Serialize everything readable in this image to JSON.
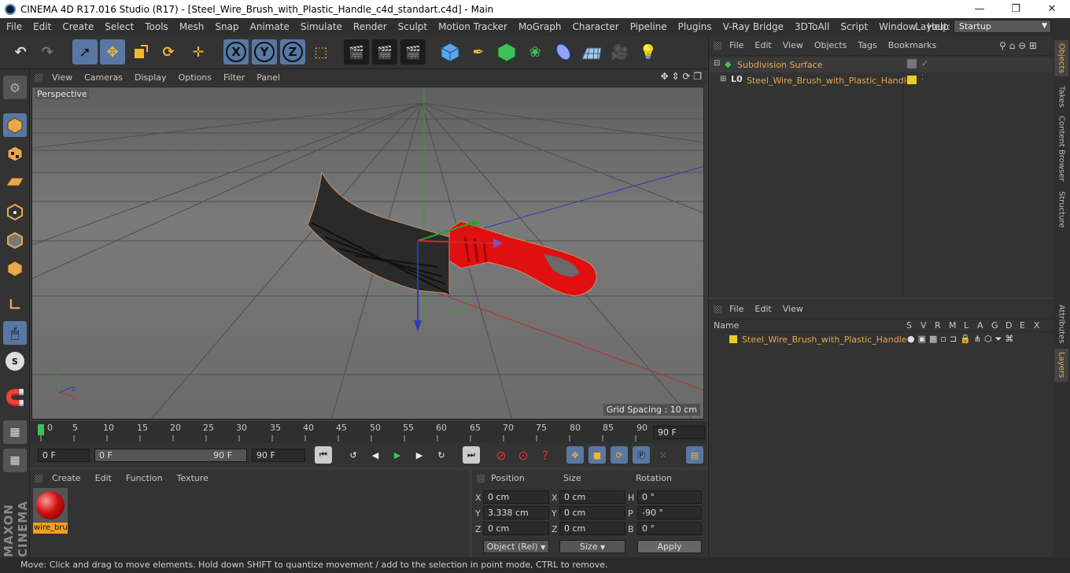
{
  "window": {
    "title": "CINEMA 4D R17.016 Studio (R17) - [Steel_Wire_Brush_with_Plastic_Handle_c4d_standart.c4d] - Main"
  },
  "menubar": {
    "items": [
      "File",
      "Edit",
      "Create",
      "Select",
      "Tools",
      "Mesh",
      "Snap",
      "Animate",
      "Simulate",
      "Render",
      "Sculpt",
      "Motion Tracker",
      "MoGraph",
      "Character",
      "Pipeline",
      "Plugins",
      "V-Ray Bridge",
      "3DToAll",
      "Script",
      "Window",
      "Help"
    ],
    "layout_label": "Layout:",
    "layout_value": "Startup"
  },
  "toolbar": {
    "axis_labels": [
      "X",
      "Y",
      "Z"
    ]
  },
  "viewport": {
    "menu": [
      "View",
      "Cameras",
      "Display",
      "Options",
      "Filter",
      "Panel"
    ],
    "camera_label": "Perspective",
    "grid_spacing": "Grid Spacing : 10 cm"
  },
  "timeline": {
    "ticks": [
      "0",
      "5",
      "10",
      "15",
      "20",
      "25",
      "30",
      "35",
      "40",
      "45",
      "50",
      "55",
      "60",
      "65",
      "70",
      "75",
      "80",
      "85",
      "90"
    ],
    "current_frame": "90 F",
    "start_field": "0 F",
    "range_start": "0 F",
    "range_end": "90 F",
    "end_field": "90 F"
  },
  "material_manager": {
    "menu": [
      "Create",
      "Edit",
      "Function",
      "Texture"
    ],
    "material_name": "wire_bru"
  },
  "coordinates": {
    "headers": [
      "Position",
      "Size",
      "Rotation"
    ],
    "rows": [
      {
        "axis": "X",
        "pos": "0 cm",
        "size_axis": "X",
        "size": "0 cm",
        "rot_axis": "H",
        "rot": "0 °"
      },
      {
        "axis": "Y",
        "pos": "3.338 cm",
        "size_axis": "Y",
        "size": "0 cm",
        "rot_axis": "P",
        "rot": "-90 °"
      },
      {
        "axis": "Z",
        "pos": "0 cm",
        "size_axis": "Z",
        "size": "0 cm",
        "rot_axis": "B",
        "rot": "0 °"
      }
    ],
    "mode_select": "Object (Rel)",
    "size_select": "Size",
    "apply_label": "Apply"
  },
  "object_manager": {
    "menu": [
      "File",
      "Edit",
      "View",
      "Objects",
      "Tags",
      "Bookmarks"
    ],
    "objects": [
      "Subdivision Surface",
      "Steel_Wire_Brush_with_Plastic_Handle"
    ]
  },
  "layer_manager": {
    "menu": [
      "File",
      "Edit",
      "View"
    ],
    "header_name": "Name",
    "columns": [
      "S",
      "V",
      "R",
      "M",
      "L",
      "A",
      "G",
      "D",
      "E",
      "X"
    ],
    "layers": [
      "Steel_Wire_Brush_with_Plastic_Handle"
    ]
  },
  "side_tabs": [
    "Objects",
    "Takes",
    "Content Browser",
    "Structure",
    "Attributes",
    "Layers"
  ],
  "status": {
    "text": "Move: Click and drag to move elements. Hold down SHIFT to quantize movement / add to the selection in point mode, CTRL to remove."
  },
  "colors": {
    "accent": "#e8a94b",
    "selection": "#5878a3",
    "handle": "#e01010",
    "layer": "#e8d020"
  }
}
